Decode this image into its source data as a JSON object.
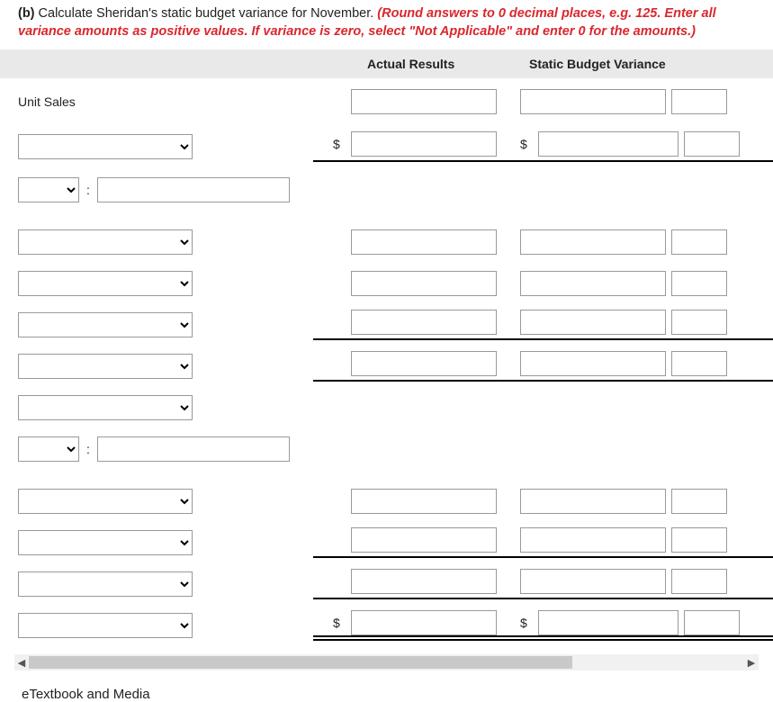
{
  "question": {
    "part_label": "(b)",
    "prompt_plain": " Calculate Sheridan's static budget variance for November. ",
    "prompt_red": "(Round answers to 0 decimal places, e.g. 125. Enter all variance amounts as positive values. If variance is zero, select \"Not Applicable\" and enter 0 for the amounts.)"
  },
  "columns": {
    "actual": "Actual Results",
    "variance": "Static Budget Variance"
  },
  "rows": {
    "unit_sales_label": "Unit Sales"
  },
  "symbols": {
    "dollar": "$",
    "colon": ":"
  },
  "footer": {
    "etextbook": "eTextbook and Media"
  }
}
